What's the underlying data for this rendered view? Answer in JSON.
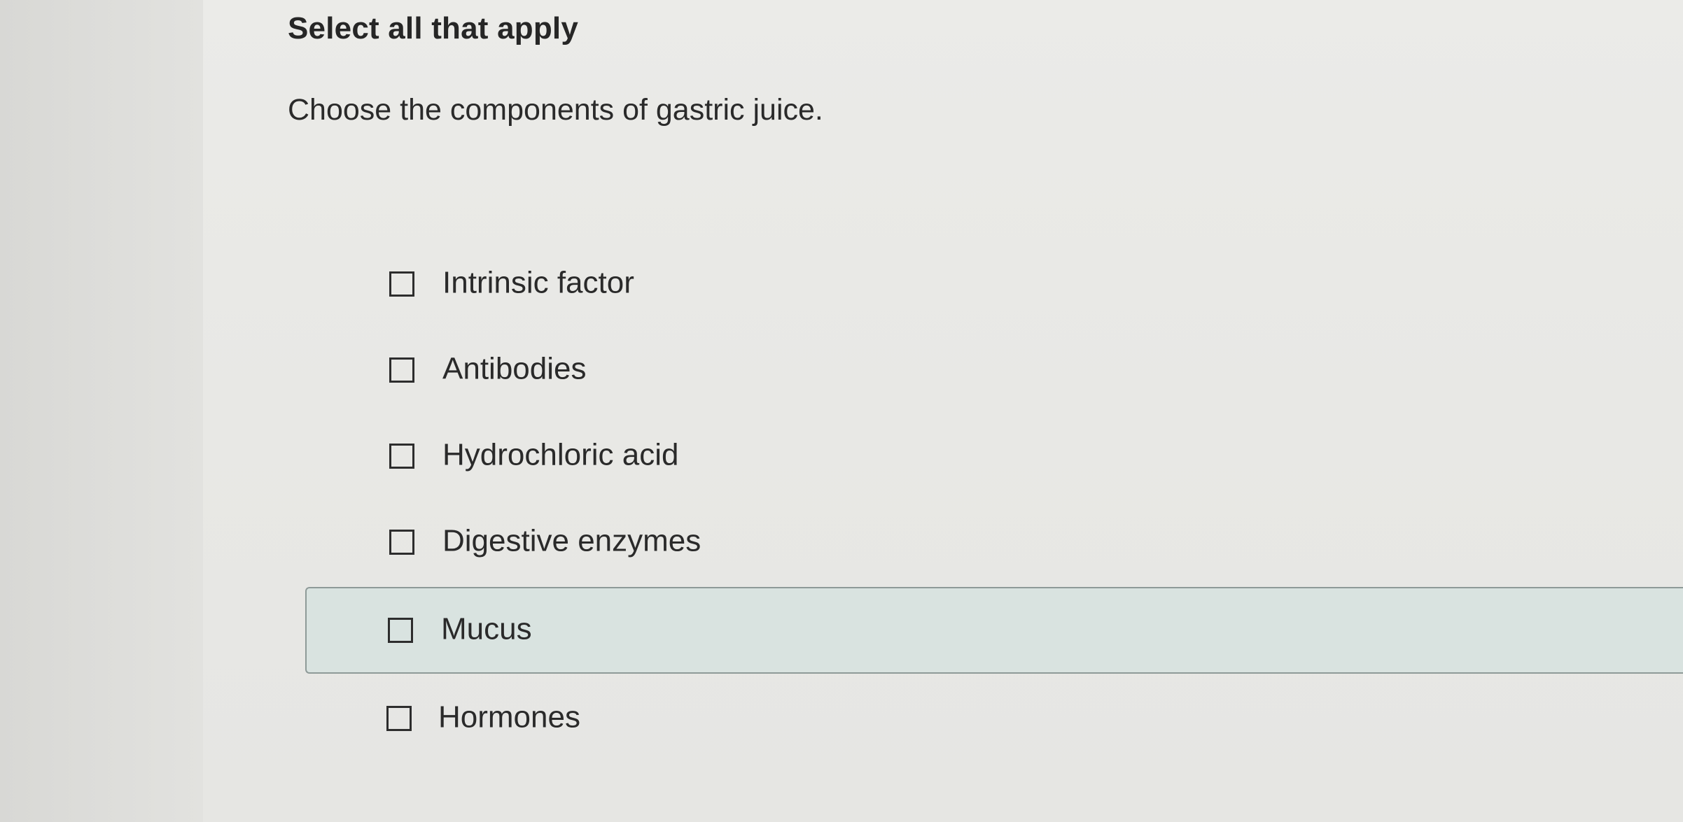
{
  "instruction": "Select all that apply",
  "question": "Choose the components of gastric juice.",
  "options": [
    {
      "label": "Intrinsic factor",
      "checked": false
    },
    {
      "label": "Antibodies",
      "checked": false
    },
    {
      "label": "Hydrochloric acid",
      "checked": false
    },
    {
      "label": "Digestive enzymes",
      "checked": false
    },
    {
      "label": "Mucus",
      "checked": false,
      "hovered": true
    },
    {
      "label": "Hormones",
      "checked": false
    }
  ],
  "colors": {
    "highlight_background": "#d9e3e0",
    "highlight_border": "#8e9a98",
    "text": "#2a2a2a"
  }
}
